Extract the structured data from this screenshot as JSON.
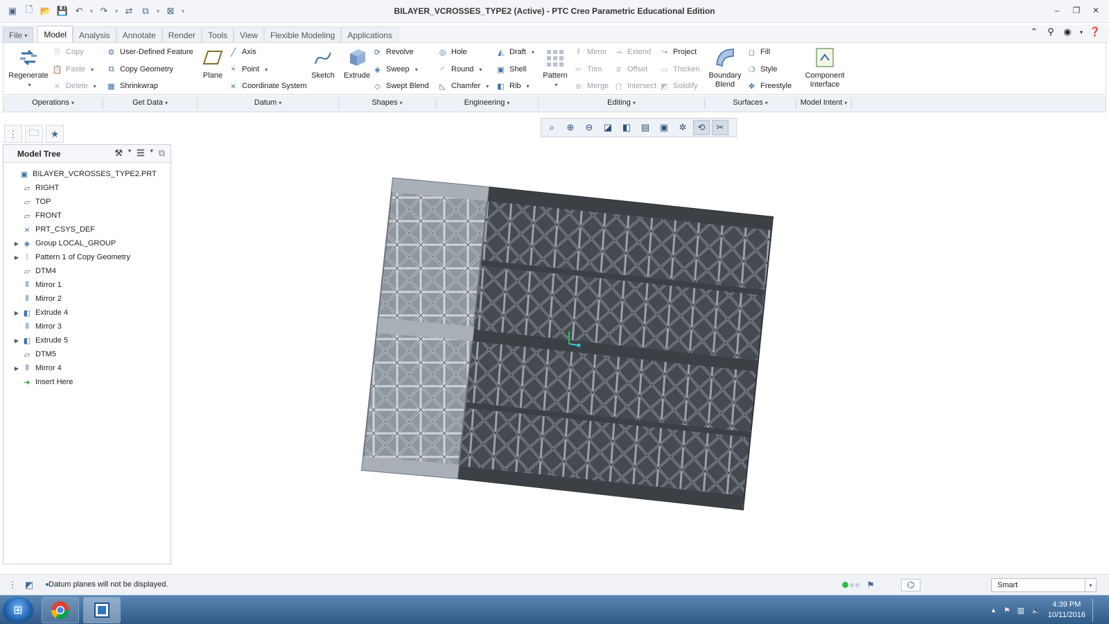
{
  "window": {
    "title": "BILAYER_VCROSSES_TYPE2 (Active) - PTC Creo Parametric Educational Edition"
  },
  "tabs": [
    {
      "label": "File"
    },
    {
      "label": "Model"
    },
    {
      "label": "Analysis"
    },
    {
      "label": "Annotate"
    },
    {
      "label": "Render"
    },
    {
      "label": "Tools"
    },
    {
      "label": "View"
    },
    {
      "label": "Flexible Modeling"
    },
    {
      "label": "Applications"
    }
  ],
  "ribbon": {
    "regenerate": "Regenerate",
    "copy": "Copy",
    "paste": "Paste",
    "delete": "Delete",
    "user_defined_feature": "User-Defined Feature",
    "copy_geometry": "Copy Geometry",
    "shrinkwrap": "Shrinkwrap",
    "plane": "Plane",
    "axis": "Axis",
    "point": "Point",
    "coordinate_system": "Coordinate System",
    "sketch": "Sketch",
    "extrude": "Extrude",
    "revolve": "Revolve",
    "sweep": "Sweep",
    "swept_blend": "Swept Blend",
    "hole": "Hole",
    "round": "Round",
    "chamfer": "Chamfer",
    "draft": "Draft",
    "shell": "Shell",
    "rib": "Rib",
    "pattern": "Pattern",
    "mirror": "Mirror",
    "trim": "Trim",
    "merge": "Merge",
    "extend": "Extend",
    "offset": "Offset",
    "intersect": "Intersect",
    "project": "Project",
    "thicken": "Thicken",
    "solidify": "Solidify",
    "boundary_blend_1": "Boundary",
    "boundary_blend_2": "Blend",
    "fill": "Fill",
    "style": "Style",
    "freestyle": "Freestyle",
    "component_interface_1": "Component",
    "component_interface_2": "Interface"
  },
  "groups": [
    {
      "label": "Operations"
    },
    {
      "label": "Get Data"
    },
    {
      "label": "Datum"
    },
    {
      "label": "Shapes"
    },
    {
      "label": "Engineering"
    },
    {
      "label": "Editing"
    },
    {
      "label": "Surfaces"
    },
    {
      "label": "Model Intent"
    }
  ],
  "model_tree": {
    "header": "Model Tree",
    "items": [
      {
        "label": "BILAYER_VCROSSES_TYPE2.PRT",
        "icon": "part-icon",
        "expandable": false
      },
      {
        "label": "RIGHT",
        "icon": "datum-plane-icon",
        "expandable": false
      },
      {
        "label": "TOP",
        "icon": "datum-plane-icon",
        "expandable": false
      },
      {
        "label": "FRONT",
        "icon": "datum-plane-icon",
        "expandable": false
      },
      {
        "label": "PRT_CSYS_DEF",
        "icon": "csys-icon",
        "expandable": false
      },
      {
        "label": "Group LOCAL_GROUP",
        "icon": "group-icon",
        "expandable": true
      },
      {
        "label": "Pattern 1 of Copy Geometry",
        "icon": "pattern-icon",
        "expandable": true
      },
      {
        "label": "DTM4",
        "icon": "datum-plane-icon",
        "expandable": false
      },
      {
        "label": "Mirror 1",
        "icon": "mirror-icon",
        "expandable": false
      },
      {
        "label": "Mirror 2",
        "icon": "mirror-icon",
        "expandable": false
      },
      {
        "label": "Extrude 4",
        "icon": "extrude-icon",
        "expandable": true
      },
      {
        "label": "Mirror 3",
        "icon": "mirror-icon",
        "expandable": false
      },
      {
        "label": "Extrude 5",
        "icon": "extrude-icon",
        "expandable": true
      },
      {
        "label": "DTM5",
        "icon": "datum-plane-icon",
        "expandable": false
      },
      {
        "label": "Mirror 4",
        "icon": "mirror-icon",
        "expandable": true
      },
      {
        "label": "Insert Here",
        "icon": "insert-here-icon",
        "expandable": false
      }
    ]
  },
  "status": {
    "message": "Datum planes will not be displayed.",
    "selection_filter": "Smart"
  },
  "taskbar": {
    "time": "4:39 PM",
    "date": "10/11/2016"
  },
  "colors": {
    "lattice_light": "#8e969f",
    "lattice_dark": "#4c5157",
    "accent": "#3b6fa8"
  }
}
